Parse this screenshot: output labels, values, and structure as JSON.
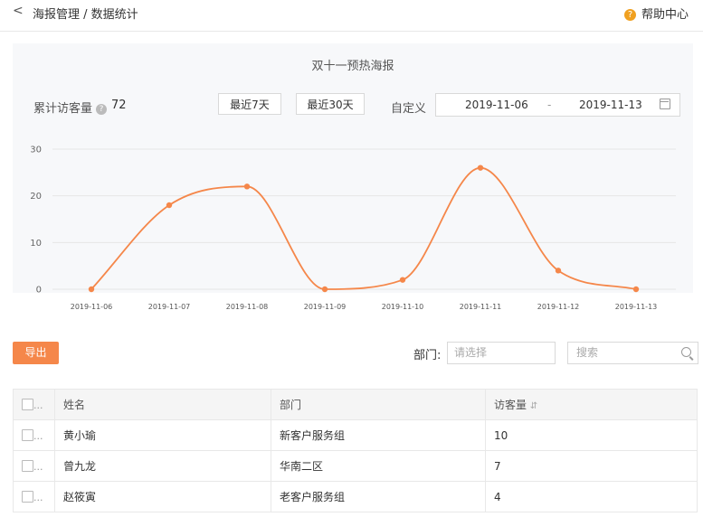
{
  "nav": {
    "back_icon": "chevron-left-icon",
    "breadcrumb": "海报管理 / 数据统计",
    "help_label": "帮助中心",
    "help_icon": "question-circle-icon"
  },
  "panel": {
    "title": "双十一预热海报",
    "stat_label": "累计访客量",
    "stat_value": "72",
    "btn_7days": "最近7天",
    "btn_30days": "最近30天",
    "custom_label": "自定义",
    "date_start": "2019-11-06",
    "date_sep": "-",
    "date_end": "2019-11-13"
  },
  "chart_data": {
    "type": "line",
    "categories": [
      "2019-11-06",
      "2019-11-07",
      "2019-11-08",
      "2019-11-09",
      "2019-11-10",
      "2019-11-11",
      "2019-11-12",
      "2019-11-13"
    ],
    "series": [
      {
        "values": [
          0,
          18,
          22,
          0,
          2,
          26,
          4,
          0
        ]
      }
    ],
    "yticks": [
      "0",
      "10",
      "20",
      "30"
    ],
    "ylim": [
      0,
      30
    ],
    "color": "#f5874a",
    "grid": true,
    "smooth": true
  },
  "toolbar": {
    "export_label": "导出",
    "dept_label": "部门:",
    "dept_placeholder": "请选择",
    "search_placeholder": "搜索"
  },
  "table": {
    "select_all_more": "...",
    "headers": [
      "姓名",
      "部门",
      "访客量"
    ],
    "sort_icon": "⇵",
    "rows": [
      {
        "more": "...",
        "name": "黄小瑜",
        "dept": "新客户服务组",
        "visits": "10"
      },
      {
        "more": "...",
        "name": "曾九龙",
        "dept": "华南二区",
        "visits": "7"
      },
      {
        "more": "...",
        "name": "赵筱寅",
        "dept": "老客户服务组",
        "visits": "4"
      }
    ]
  }
}
